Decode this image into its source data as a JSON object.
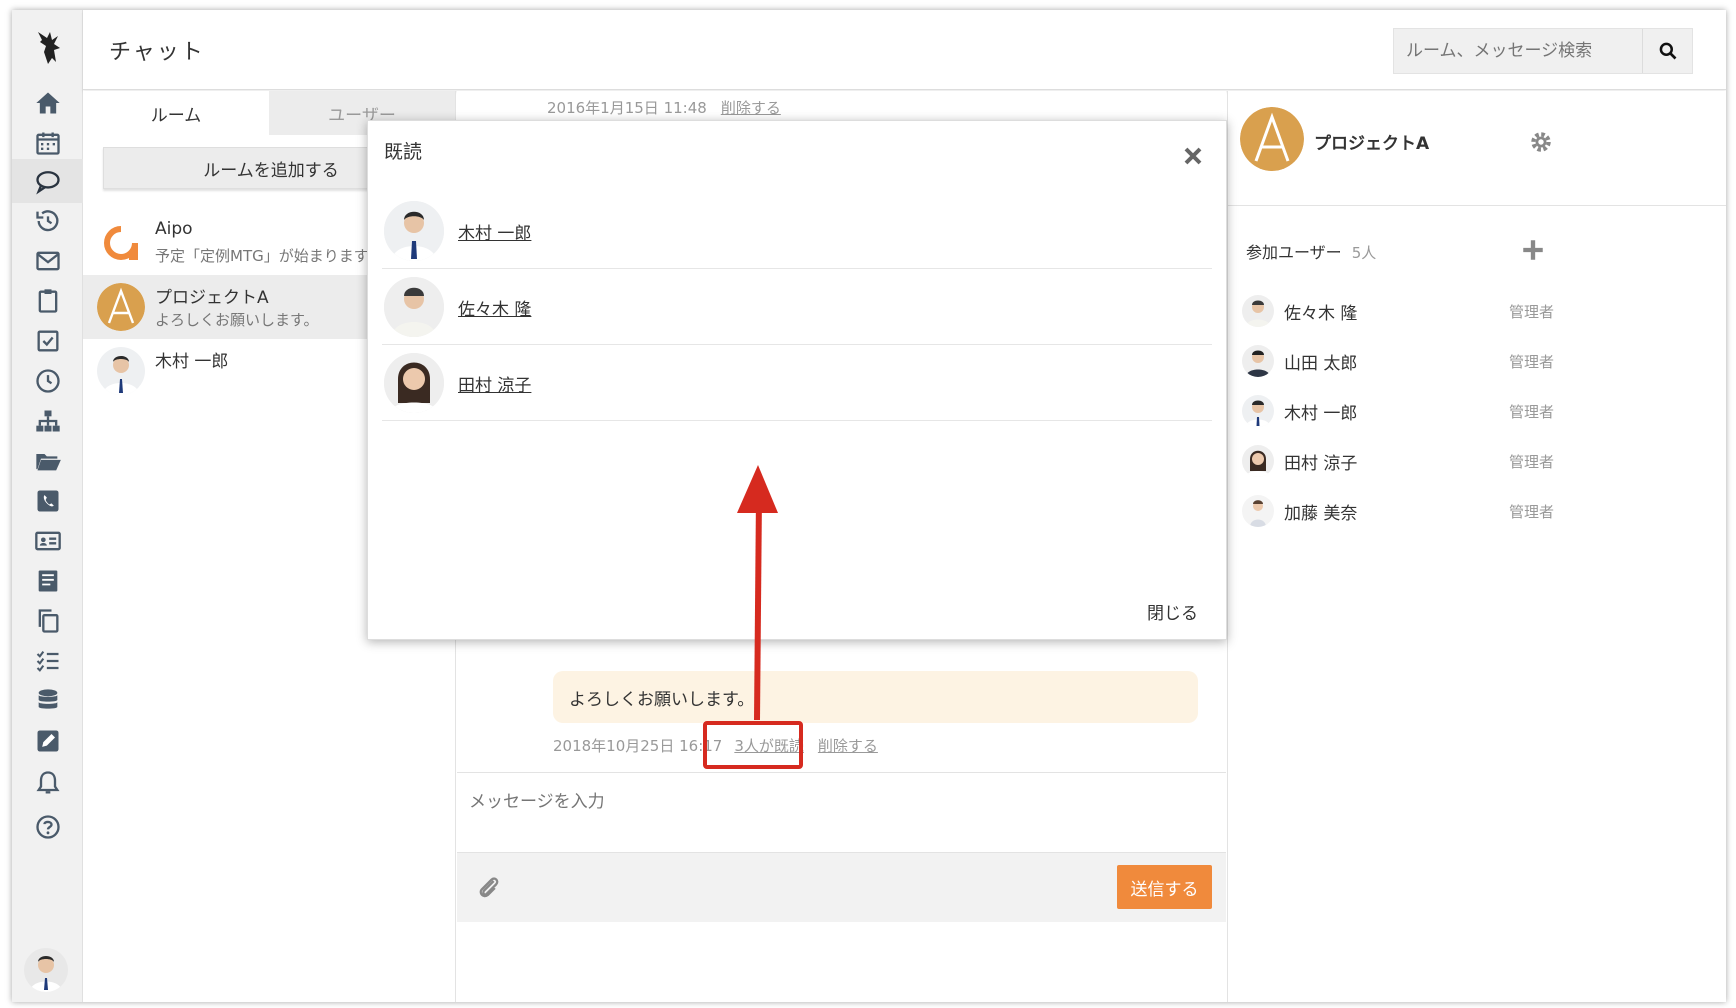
{
  "header": {
    "title": "チャット",
    "search_placeholder": "ルーム、メッセージ検索"
  },
  "rail": {
    "icons": [
      "home-icon",
      "calendar-icon",
      "chat-icon",
      "history-icon",
      "mail-icon",
      "clipboard-icon",
      "checkbox-icon",
      "clock-icon",
      "org-chart-icon",
      "folder-icon",
      "phone-book-icon",
      "id-card-icon",
      "notebook-icon",
      "copy-icon",
      "checklist-icon",
      "database-icon",
      "edit-icon",
      "bell-icon",
      "help-icon"
    ]
  },
  "rooms_pane": {
    "tabs": [
      "ルーム",
      "ユーザー"
    ],
    "add_room_label": "ルームを追加する",
    "rooms": [
      {
        "name": "Aipo",
        "preview": "予定「定例MTG」が始まります"
      },
      {
        "name": "プロジェクトA",
        "preview": "よろしくお願いします。"
      },
      {
        "name": "木村 一郎",
        "preview": ""
      }
    ]
  },
  "chat": {
    "top_meta": {
      "timestamp": "2016年1月15日 11:48",
      "delete_label": "削除する"
    },
    "message": {
      "text": "よろしくお願いします。",
      "timestamp": "2018年10月25日 16:17",
      "read_label": "3人が既読",
      "delete_label": "削除する"
    },
    "composer_placeholder": "メッセージを入力",
    "send_label": "送信する"
  },
  "info_panel": {
    "room_name": "プロジェクトA",
    "participants_title": "参加ユーザー",
    "participants_count": "5人",
    "participants": [
      {
        "name": "佐々木 隆",
        "role": "管理者"
      },
      {
        "name": "山田 太郎",
        "role": "管理者"
      },
      {
        "name": "木村 一郎",
        "role": "管理者"
      },
      {
        "name": "田村 涼子",
        "role": "管理者"
      },
      {
        "name": "加藤 美奈",
        "role": "管理者"
      }
    ]
  },
  "read_modal": {
    "title": "既読",
    "readers": [
      "木村 一郎",
      "佐々木 隆",
      "田村 涼子"
    ],
    "close_label": "閉じる"
  },
  "colors": {
    "accent_orange": "#f08a3c",
    "avatar_gold": "#d9a04e",
    "annotation_red": "#d62a1f",
    "bubble_bg": "#fdf3e3"
  }
}
